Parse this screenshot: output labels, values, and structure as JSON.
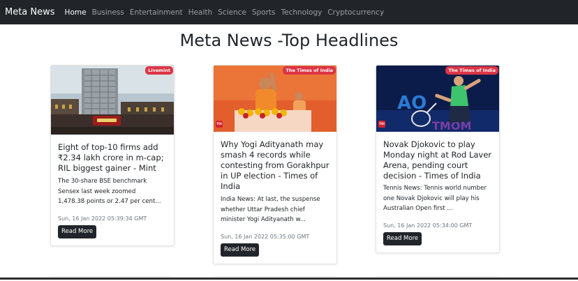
{
  "navbar": {
    "brand": "Meta News",
    "items": [
      {
        "label": "Home",
        "active": true
      },
      {
        "label": "Business",
        "active": false
      },
      {
        "label": "Entertainment",
        "active": false
      },
      {
        "label": "Health",
        "active": false
      },
      {
        "label": "Science",
        "active": false
      },
      {
        "label": "Sports",
        "active": false
      },
      {
        "label": "Technology",
        "active": false
      },
      {
        "label": "Cryptocurrency",
        "active": false
      }
    ]
  },
  "page": {
    "title": "Meta News -Top Headlines"
  },
  "cards": [
    {
      "source": "Livemint",
      "title": "Eight of top-10 firms add ₹2.34 lakh crore in m-cap; RIL biggest gainer - Mint",
      "description": "The 30-share BSE benchmark Sensex last week zoomed 1,478.38 points or 2.47 per cent...",
      "date": "Sun, 16 Jan 2022 05:39:34 GMT",
      "button": "Read More",
      "image": "stock-exchange-building-photo"
    },
    {
      "source": "The Times of India",
      "title": "Why Yogi Adityanath may smash 4 records while contesting from Gorakhpur in UP election - Times of India",
      "description": "India News: At last, the suspense whether Uttar Pradesh chief minister Yogi Adityanath w...",
      "date": "Sun, 16 Jan 2022 05:35:00 GMT",
      "button": "Read More",
      "image": "politician-speech-photo",
      "logo_text": "TOI"
    },
    {
      "source": "The Times of India",
      "title": "Novak Djokovic to play Monday night at Rod Laver Arena, pending court decision - Times of India",
      "description": "Tennis News: Tennis world number one Novak Djokovic will play his Australian Open first ...",
      "date": "Sun, 16 Jan 2022 05:34:00 GMT",
      "button": "Read More",
      "image": "tennis-player-photo",
      "logo_text": "TOI"
    }
  ],
  "colors": {
    "navbar_bg": "#212529",
    "badge_bg": "#dc3545",
    "button_bg": "#212529",
    "date_text": "#6c757d"
  }
}
